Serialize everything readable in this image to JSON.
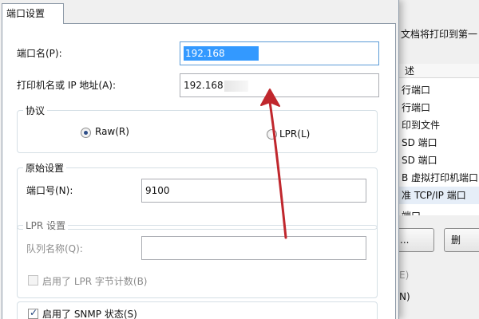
{
  "dialog": {
    "tab_label": "端口设置",
    "port_name_label": "端口名(P):",
    "port_name_value": "192.168",
    "printer_address_label": "打印机名或 IP 地址(A):",
    "printer_address_value": "192.168",
    "protocol": {
      "title": "协议",
      "raw_label": "Raw(R)",
      "lpr_label": "LPR(L)",
      "selected": "raw"
    },
    "raw_settings": {
      "title": "原始设置",
      "port_number_label": "端口号(N):",
      "port_number_value": "9100"
    },
    "lpr_settings": {
      "title": "LPR 设置",
      "queue_name_label": "队列名称(Q):",
      "queue_name_value": "",
      "byte_count_label": "启用了 LPR 字节计数(B)",
      "byte_count_checked": false
    },
    "snmp": {
      "label": "启用了 SNMP 状态(S)",
      "checked": true
    }
  },
  "background_window": {
    "description_fragment": "文档将打印到第一",
    "list_header": "述",
    "port_items": [
      "行端口",
      "行端口",
      "印到文件",
      "SD 端口",
      "SD 端口",
      "B 虚拟打印机端口",
      "准 TCP/IP 端口",
      "端口"
    ],
    "selected_index": 6,
    "button_1_label": "...",
    "button_2_label": "删",
    "item_e": "E)",
    "item_n": "N)"
  },
  "colors": {
    "selection_highlight": "#3399ff",
    "annotation_arrow": "#c0272d",
    "focus_border": "#5c9bd6"
  }
}
